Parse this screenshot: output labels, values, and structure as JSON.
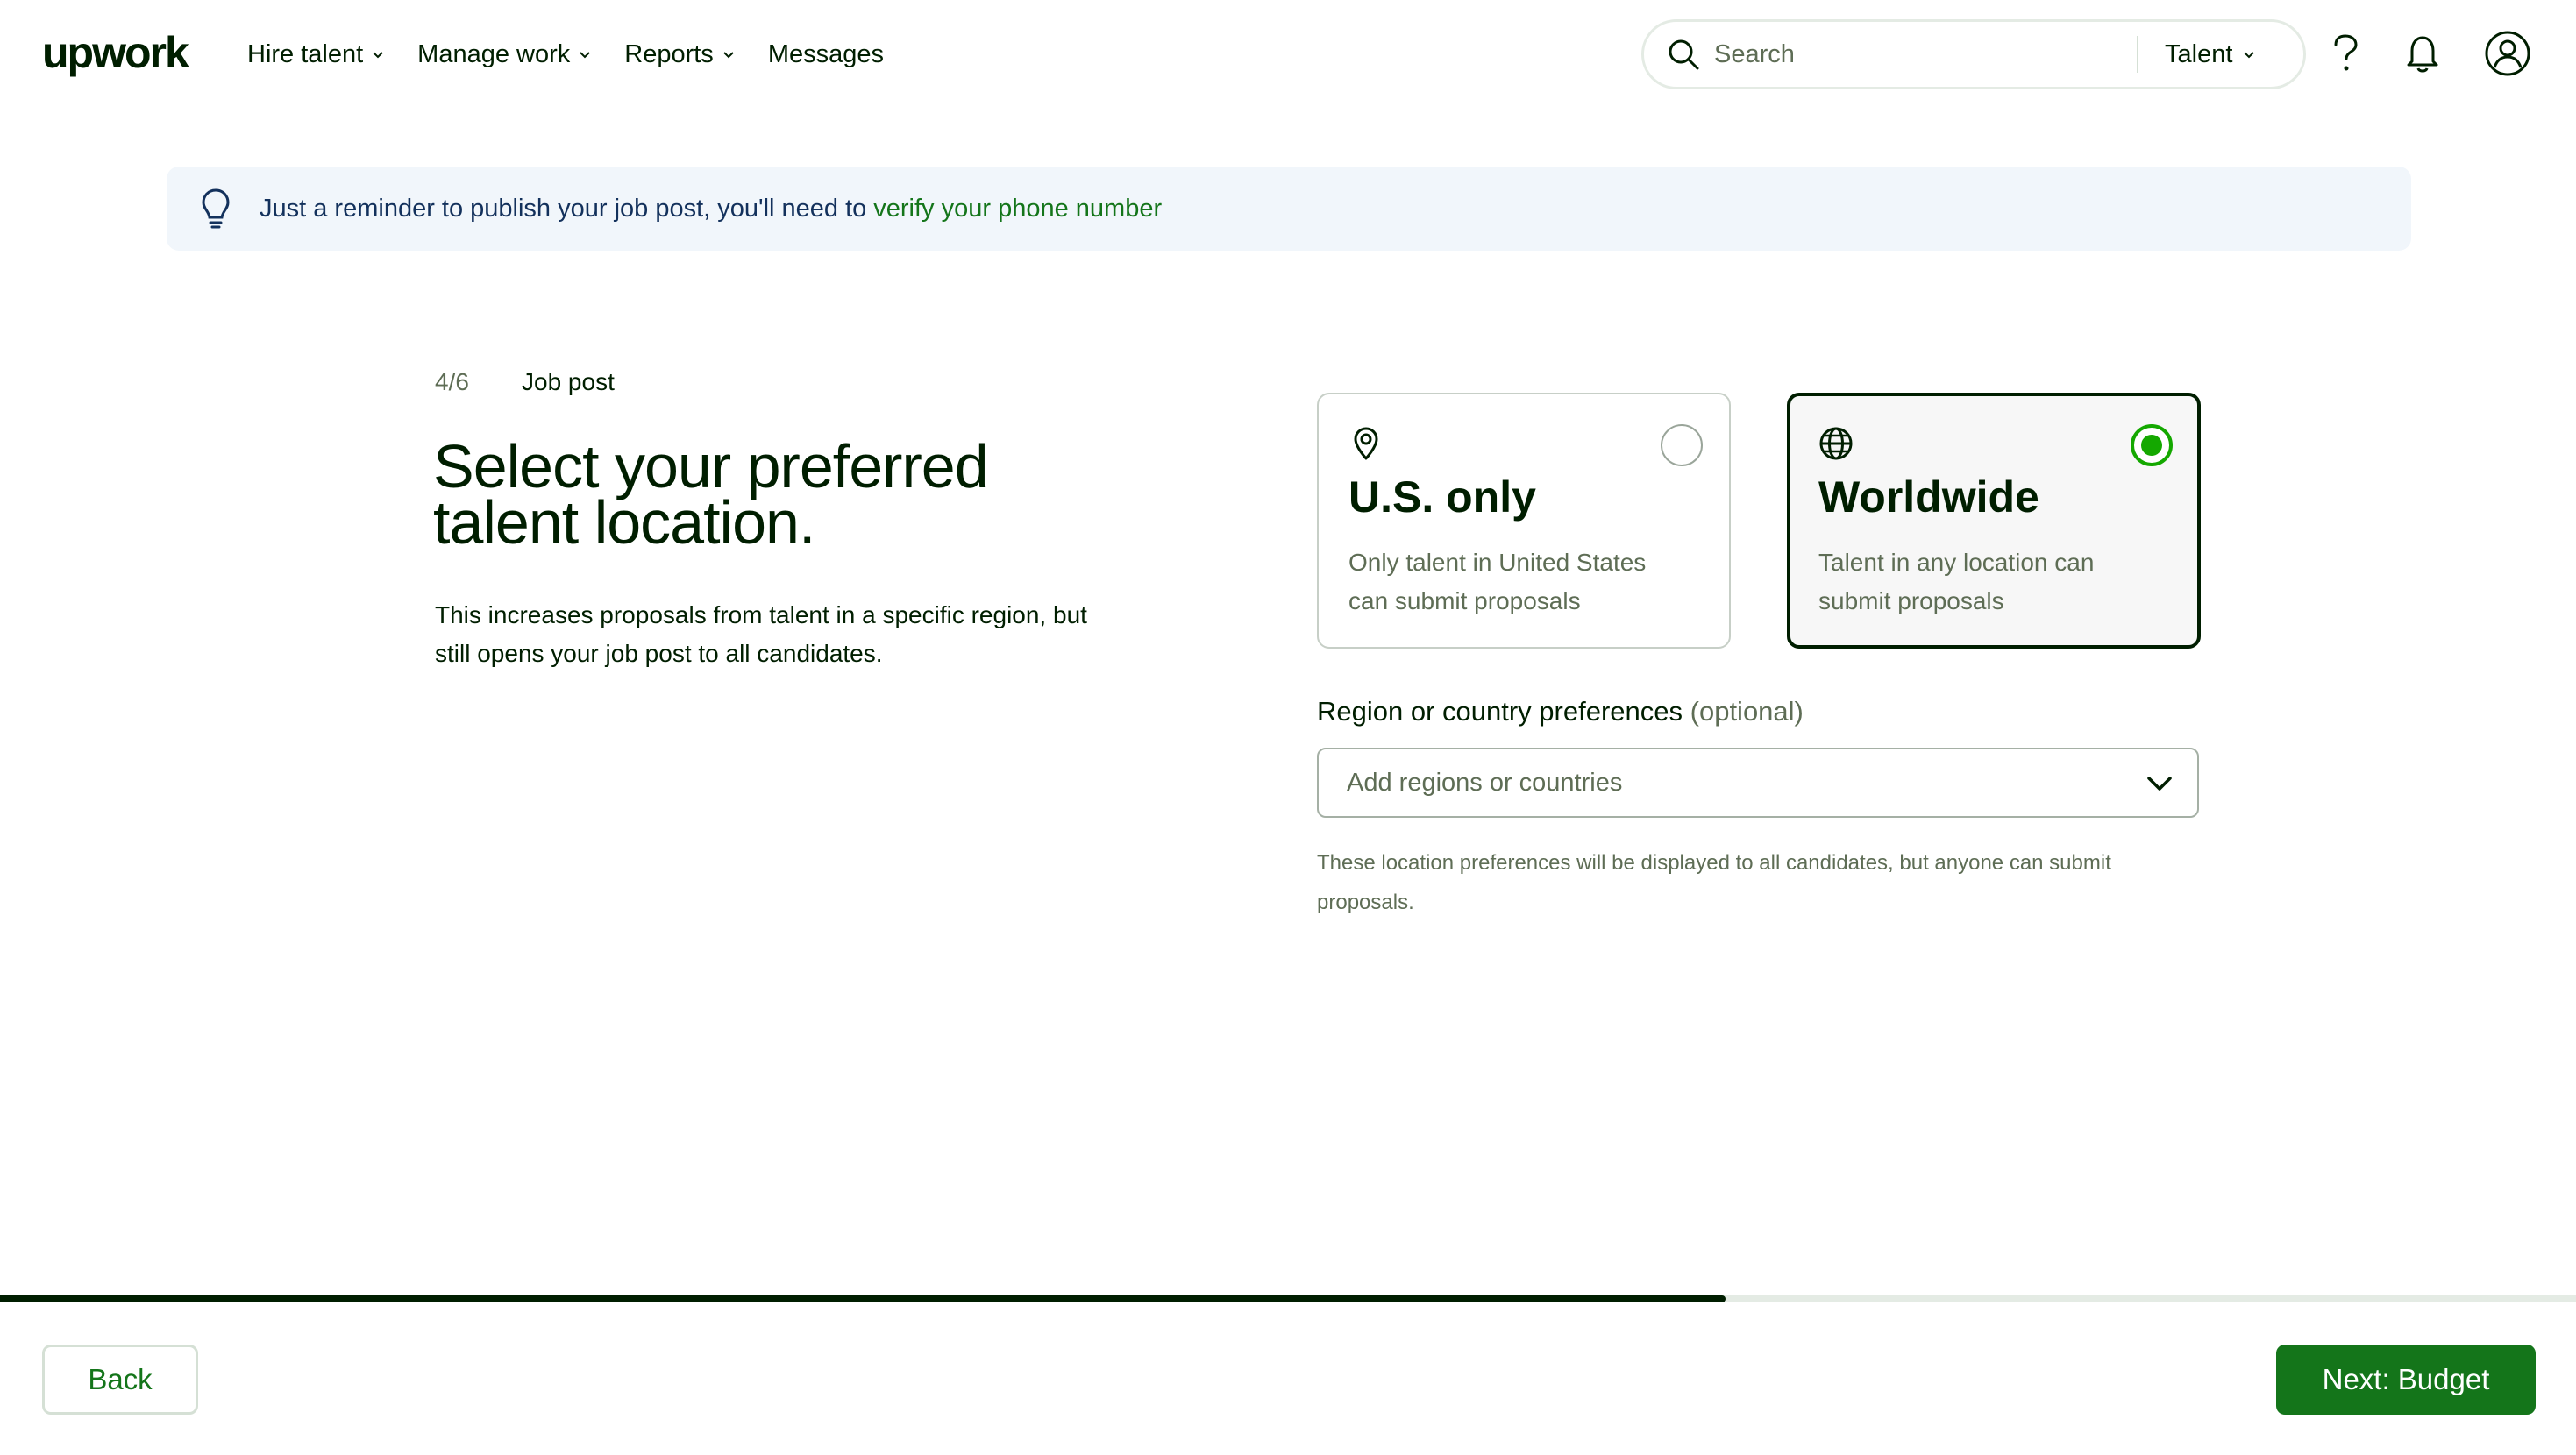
{
  "header": {
    "logo": "upwork",
    "nav": [
      {
        "label": "Hire talent",
        "has_dropdown": true
      },
      {
        "label": "Manage work",
        "has_dropdown": true
      },
      {
        "label": "Reports",
        "has_dropdown": true
      },
      {
        "label": "Messages",
        "has_dropdown": false
      }
    ],
    "search": {
      "placeholder": "Search",
      "value": ""
    },
    "search_scope": "Talent",
    "icons": [
      "help-icon",
      "notifications-icon",
      "account-icon"
    ]
  },
  "banner": {
    "text": "Just a reminder to publish your job post, you'll need to",
    "link": "verify your phone number"
  },
  "step": {
    "counter": "4/6",
    "name": "Job post"
  },
  "main": {
    "title": "Select your preferred talent location.",
    "description": "This increases proposals from talent in a specific region, but still opens your job post to all candidates."
  },
  "options": [
    {
      "id": "us",
      "icon": "location-pin-icon",
      "title": "U.S. only",
      "description": "Only talent in United States can submit proposals",
      "selected": false
    },
    {
      "id": "worldwide",
      "icon": "globe-icon",
      "title": "Worldwide",
      "description": "Talent in any location can submit proposals",
      "selected": true
    }
  ],
  "region": {
    "label": "Region or country preferences",
    "optional": "(optional)",
    "placeholder": "Add regions or countries",
    "note": "These location preferences will be displayed to all candidates, but anyone can submit proposals."
  },
  "progress": {
    "step": 4,
    "total": 6,
    "fraction": 0.67
  },
  "footer": {
    "back_label": "Back",
    "next_label": "Next: Budget"
  },
  "colors": {
    "brand_green": "#14751a",
    "radio_green": "#14a800",
    "text_dark": "#001e00",
    "text_muted": "#5e6d55",
    "banner_bg": "#f1f6fb",
    "banner_text": "#13315c"
  }
}
